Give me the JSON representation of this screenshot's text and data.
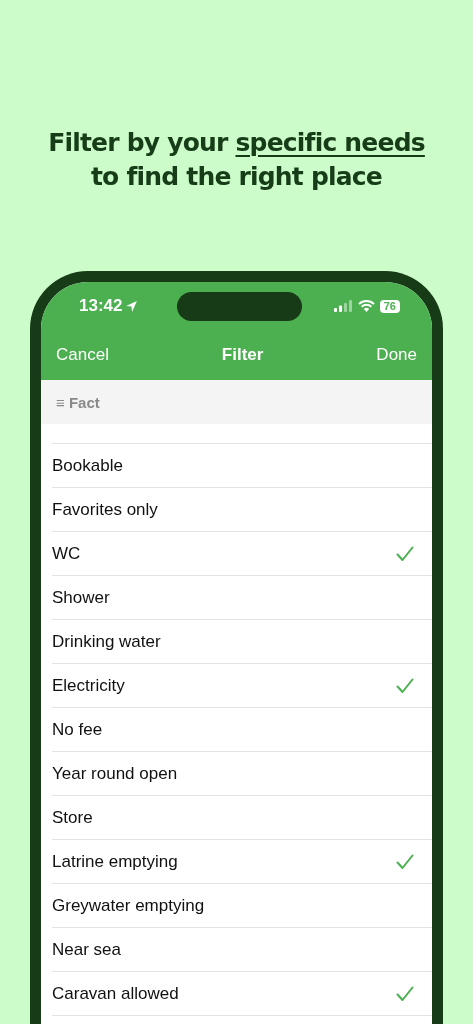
{
  "headline": {
    "before": "Filter by your",
    "emphasis": "specific needs",
    "after": "to find the right place"
  },
  "status_bar": {
    "time": "13:42",
    "battery": "76"
  },
  "nav": {
    "left": "Cancel",
    "title": "Filter",
    "right": "Done"
  },
  "section": {
    "icon": "≡",
    "title": "Fact"
  },
  "rows": [
    {
      "label": "Bookable",
      "checked": false
    },
    {
      "label": "Favorites only",
      "checked": false
    },
    {
      "label": "WC",
      "checked": true
    },
    {
      "label": "Shower",
      "checked": false
    },
    {
      "label": "Drinking water",
      "checked": false
    },
    {
      "label": "Electricity",
      "checked": true
    },
    {
      "label": "No fee",
      "checked": false
    },
    {
      "label": "Year round open",
      "checked": false
    },
    {
      "label": "Store",
      "checked": false
    },
    {
      "label": "Latrine emptying",
      "checked": true
    },
    {
      "label": "Greywater emptying",
      "checked": false
    },
    {
      "label": "Near sea",
      "checked": false
    },
    {
      "label": "Caravan allowed",
      "checked": true
    }
  ]
}
